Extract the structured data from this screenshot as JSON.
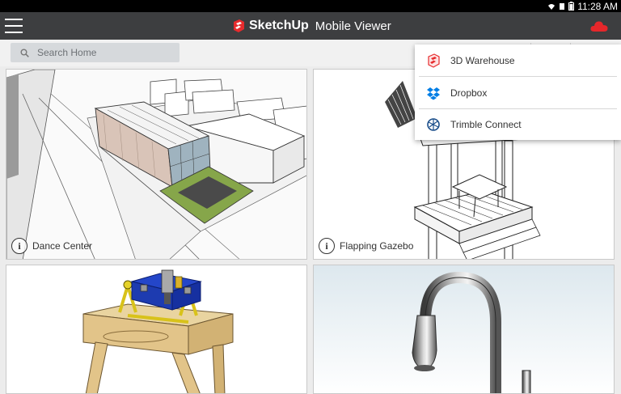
{
  "status_bar": {
    "time": "11:28 AM"
  },
  "app_bar": {
    "brand_name": "SketchUp",
    "brand_subtitle": "Mobile Viewer"
  },
  "search": {
    "placeholder": "Search Home"
  },
  "models": [
    {
      "title": "Dance Center"
    },
    {
      "title": "Flapping Gazebo"
    },
    {
      "title": ""
    },
    {
      "title": ""
    }
  ],
  "cloud_menu": {
    "items": [
      {
        "label": "3D Warehouse",
        "icon": "3d-warehouse-icon"
      },
      {
        "label": "Dropbox",
        "icon": "dropbox-icon"
      },
      {
        "label": "Trimble Connect",
        "icon": "trimble-connect-icon"
      }
    ]
  },
  "colors": {
    "app_bar": "#3d3e40",
    "brand_red": "#e72b2d",
    "cloud_red": "#e5272b",
    "dropbox_blue": "#007ee5",
    "trimble_blue": "#1b4e8a"
  }
}
